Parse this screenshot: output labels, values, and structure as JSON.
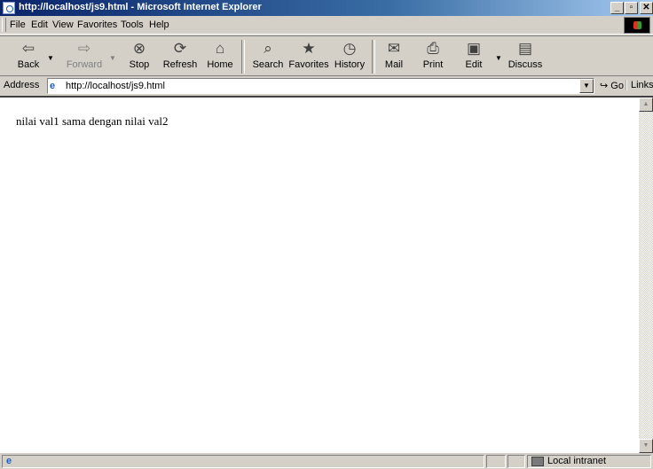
{
  "window": {
    "title": "http://localhost/js9.html - Microsoft Internet Explorer"
  },
  "menu": {
    "items": [
      "File",
      "Edit",
      "View",
      "Favorites",
      "Tools",
      "Help"
    ]
  },
  "toolbar": {
    "back": "Back",
    "forward": "Forward",
    "stop": "Stop",
    "refresh": "Refresh",
    "home": "Home",
    "search": "Search",
    "favorites": "Favorites",
    "history": "History",
    "mail": "Mail",
    "print": "Print",
    "edit": "Edit",
    "discuss": "Discuss"
  },
  "address": {
    "label": "Address",
    "url": "http://localhost/js9.html",
    "go": "Go",
    "links": "Links"
  },
  "content": {
    "text": "nilai val1 sama dengan nilai val2"
  },
  "status": {
    "zone": "Local intranet"
  },
  "icons": {
    "back": "back-arrow-icon",
    "forward": "forward-arrow-icon",
    "stop": "stop-icon",
    "refresh": "refresh-icon",
    "home": "home-icon",
    "search": "search-icon",
    "favorites": "favorites-icon",
    "history": "history-icon",
    "mail": "mail-icon",
    "print": "print-icon",
    "edit": "edit-icon",
    "discuss": "discuss-icon"
  },
  "colors": {
    "titlebar_start": "#0a246a",
    "titlebar_end": "#a6caf0",
    "chrome": "#d4d0c8"
  }
}
